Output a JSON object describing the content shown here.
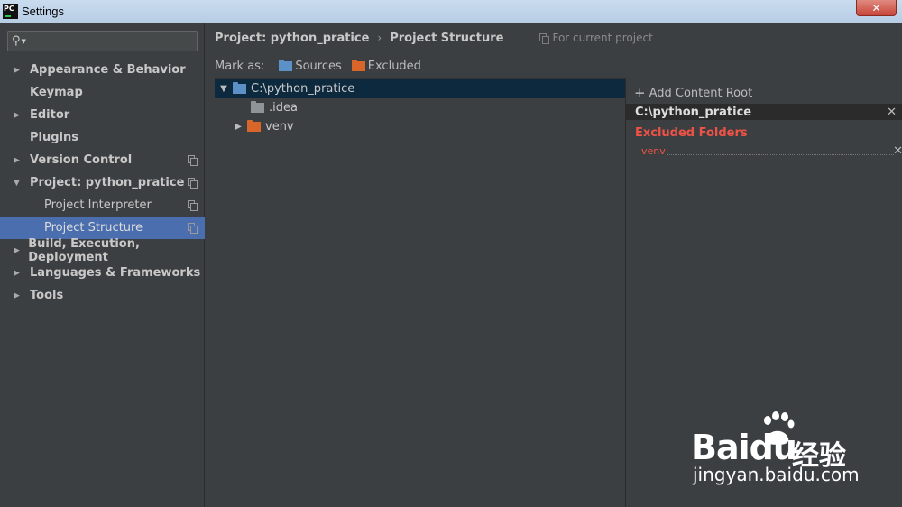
{
  "window": {
    "title": "Settings",
    "app_icon": "PC",
    "close_label": "✕"
  },
  "search": {
    "placeholder": ""
  },
  "sidebar": {
    "items": [
      {
        "label": "Appearance & Behavior",
        "arrow": "▶",
        "copy": false
      },
      {
        "label": "Keymap",
        "arrow": "",
        "copy": false
      },
      {
        "label": "Editor",
        "arrow": "▶",
        "copy": false
      },
      {
        "label": "Plugins",
        "arrow": "",
        "copy": false
      },
      {
        "label": "Version Control",
        "arrow": "▶",
        "copy": true
      },
      {
        "label": "Project: python_pratice",
        "arrow": "▼",
        "copy": true
      },
      {
        "label": "Project Interpreter",
        "arrow": "",
        "copy": true
      },
      {
        "label": "Project Structure",
        "arrow": "",
        "copy": true
      },
      {
        "label": "Build, Execution, Deployment",
        "arrow": "▶",
        "copy": false
      },
      {
        "label": "Languages & Frameworks",
        "arrow": "▶",
        "copy": false
      },
      {
        "label": "Tools",
        "arrow": "▶",
        "copy": false
      }
    ],
    "selected": "Project Structure"
  },
  "header": {
    "crumb_project": "Project: python_pratice",
    "separator": "›",
    "crumb_page": "Project Structure",
    "for_current": "For current project"
  },
  "markbar": {
    "label": "Mark as:",
    "sources": "Sources",
    "excluded": "Excluded"
  },
  "filetree": {
    "root": {
      "arrow": "▼",
      "name": "C:\\python_pratice"
    },
    "children": [
      {
        "arrow": "",
        "name": ".idea",
        "folder_color": "gray"
      },
      {
        "arrow": "▶",
        "name": "venv",
        "folder_color": "orange"
      }
    ]
  },
  "rightpanel": {
    "add_root": "Add Content Root",
    "root_path": "C:\\python_pratice",
    "excluded_title": "Excluded Folders",
    "excluded_items": [
      "venv"
    ]
  },
  "watermark": {
    "brand": "Bai",
    "brand2": "du",
    "cn": "经验",
    "url": "jingyan.baidu.com"
  },
  "colors": {
    "accent": "#4b6eaf",
    "excluded": "#ef5246",
    "source_folder": "#5b91c7",
    "excluded_folder": "#d8652a"
  }
}
